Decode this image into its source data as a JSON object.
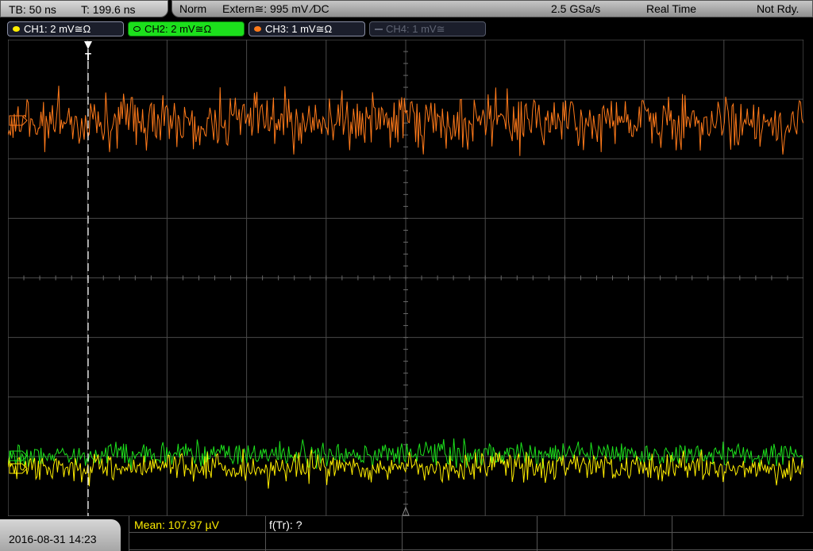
{
  "status": {
    "timebase": "TB: 50 ns",
    "trigger_time": "T: 199.6 ns",
    "mode": "Norm",
    "trigger_source": "Extern≅: 995 mV ∕DC",
    "sample_rate": "2.5 GSa/s",
    "acq_mode": "Real Time",
    "state": "Not Rdy."
  },
  "channels": [
    {
      "label": "CH1: 2 mV≅Ω",
      "color": "#ffee00"
    },
    {
      "label": "CH2: 2 mV≅Ω",
      "color": "#1ce01c"
    },
    {
      "label": "CH3: 1 mV≅Ω",
      "color": "#ff7a1a"
    },
    {
      "label": "CH4: 1 mV≅",
      "color": "#5f6473"
    }
  ],
  "trigger_marker": "T",
  "measurements": {
    "mean": "Mean: 107.97 µV",
    "ftr": "f(Tr): ?"
  },
  "timestamp": "2016-08-31 14:23",
  "colors": {
    "grid": "#4a4a4a",
    "ch1": "#ffee00",
    "ch2": "#1ce01c",
    "ch3": "#ff7a1a",
    "trigger_line": "#ffffff"
  }
}
